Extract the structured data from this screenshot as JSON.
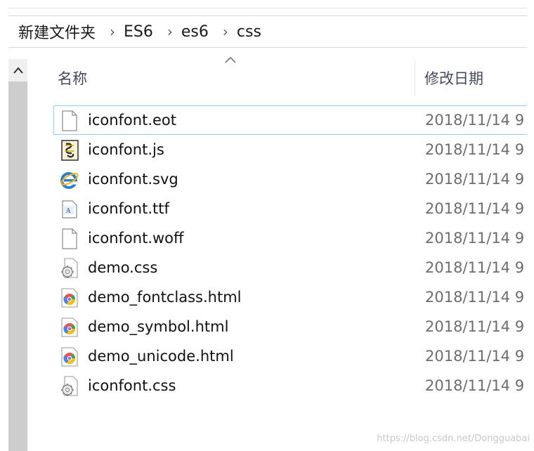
{
  "breadcrumb": [
    "新建文件夹",
    "ES6",
    "es6",
    "css"
  ],
  "breadcrumb_separator": "›",
  "columns": {
    "name": "名称",
    "date_modified": "修改日期"
  },
  "files": [
    {
      "name": "iconfont.eot",
      "date": "2018/11/14 9",
      "icon": "blank-file-icon"
    },
    {
      "name": "iconfont.js",
      "date": "2018/11/14 9",
      "icon": "script-file-icon"
    },
    {
      "name": "iconfont.svg",
      "date": "2018/11/14 9",
      "icon": "ie-file-icon"
    },
    {
      "name": "iconfont.ttf",
      "date": "2018/11/14 9",
      "icon": "font-file-icon"
    },
    {
      "name": "iconfont.woff",
      "date": "2018/11/14 9",
      "icon": "blank-file-icon"
    },
    {
      "name": "demo.css",
      "date": "2018/11/14 9",
      "icon": "css-gear-file-icon"
    },
    {
      "name": "demo_fontclass.html",
      "date": "2018/11/14 9",
      "icon": "chrome-html-file-icon"
    },
    {
      "name": "demo_symbol.html",
      "date": "2018/11/14 9",
      "icon": "chrome-html-file-icon"
    },
    {
      "name": "demo_unicode.html",
      "date": "2018/11/14 9",
      "icon": "chrome-html-file-icon"
    },
    {
      "name": "iconfont.css",
      "date": "2018/11/14 9",
      "icon": "css-gear-file-icon"
    }
  ],
  "watermark": "https://blog.csdn.net/Dongguabai"
}
